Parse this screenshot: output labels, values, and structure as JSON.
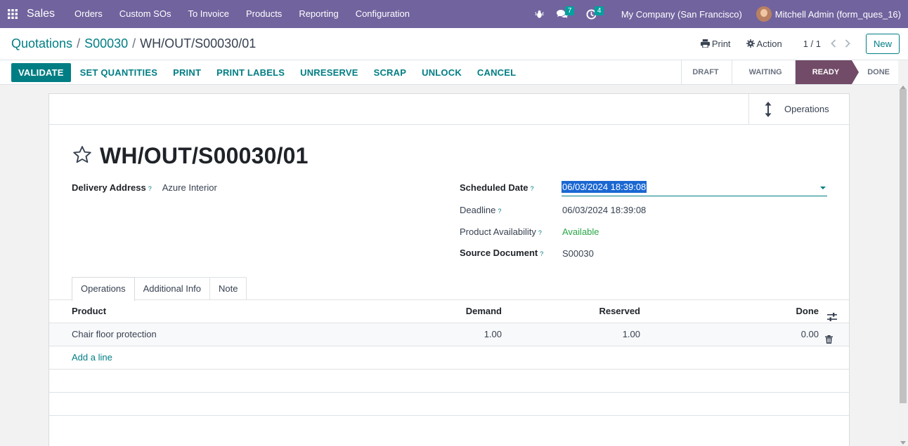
{
  "navbar": {
    "app_name": "Sales",
    "menu": [
      "Orders",
      "Custom SOs",
      "To Invoice",
      "Products",
      "Reporting",
      "Configuration"
    ],
    "messages_count": "7",
    "activities_count": "4",
    "company": "My Company (San Francisco)",
    "user": "Mitchell Admin (form_ques_16)"
  },
  "breadcrumb": {
    "root": "Quotations",
    "parent": "S00030",
    "current": "WH/OUT/S00030/01"
  },
  "control": {
    "print_label": "Print",
    "action_label": "Action",
    "pager": "1 / 1",
    "new_label": "New"
  },
  "actions": [
    "VALIDATE",
    "SET QUANTITIES",
    "PRINT",
    "PRINT LABELS",
    "UNRESERVE",
    "SCRAP",
    "UNLOCK",
    "CANCEL"
  ],
  "stages": [
    "DRAFT",
    "WAITING",
    "READY",
    "DONE"
  ],
  "active_stage": "READY",
  "smart_button": {
    "label": "Operations"
  },
  "record": {
    "title": "WH/OUT/S00030/01",
    "delivery_address_label": "Delivery Address",
    "delivery_address": "Azure Interior",
    "scheduled_date_label": "Scheduled Date",
    "scheduled_date": "06/03/2024 18:39:08",
    "deadline_label": "Deadline",
    "deadline": "06/03/2024 18:39:08",
    "availability_label": "Product Availability",
    "availability": "Available",
    "source_label": "Source Document",
    "source": "S00030",
    "help_mark": "?"
  },
  "tabs": [
    "Operations",
    "Additional Info",
    "Note"
  ],
  "table": {
    "columns": {
      "product": "Product",
      "demand": "Demand",
      "reserved": "Reserved",
      "done": "Done"
    },
    "rows": [
      {
        "product": "Chair floor protection",
        "demand": "1.00",
        "reserved": "1.00",
        "done": "0.00"
      }
    ],
    "add_line": "Add a line"
  },
  "colors": {
    "navbar": "#71639e",
    "primary": "#017e84",
    "stage_active": "#714b67",
    "available": "#28a745"
  }
}
